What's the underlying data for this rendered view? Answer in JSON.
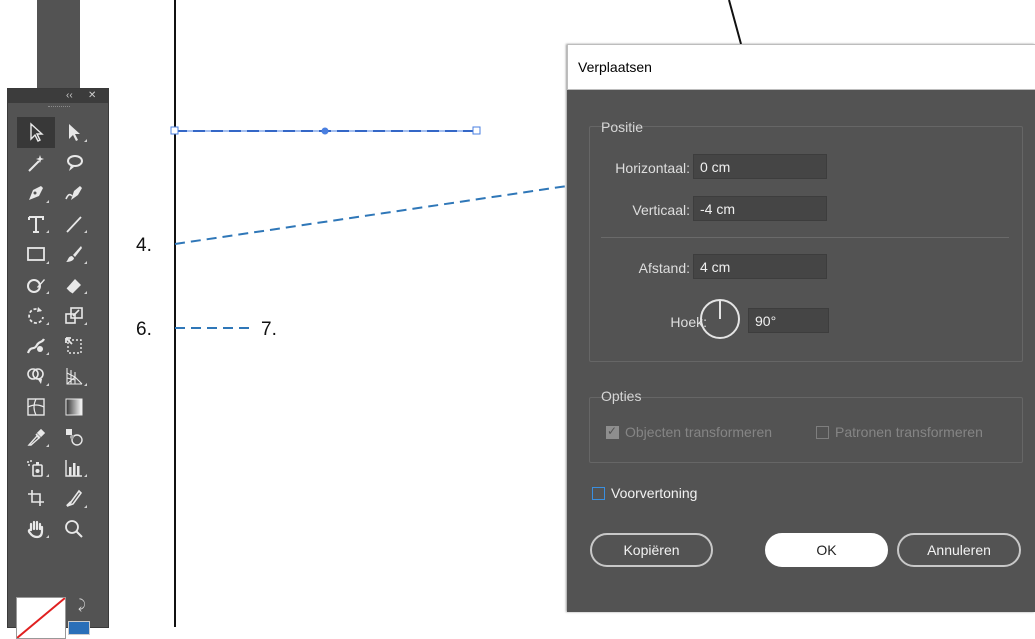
{
  "labels": {
    "item4": "4.",
    "item6": "6.",
    "item7": "7."
  },
  "toolbar": {
    "collapse": "‹‹",
    "close": "✕",
    "tools": [
      {
        "name": "selection-tool",
        "icon": "selection-arrow-icon"
      },
      {
        "name": "direct-selection-tool",
        "icon": "direct-selection-arrow-icon"
      },
      {
        "name": "magic-wand-tool",
        "icon": "magic-wand-icon"
      },
      {
        "name": "lasso-tool",
        "icon": "lasso-icon"
      },
      {
        "name": "pen-tool",
        "icon": "pen-icon"
      },
      {
        "name": "curvature-tool",
        "icon": "curvature-pen-icon"
      },
      {
        "name": "type-tool",
        "icon": "type-icon"
      },
      {
        "name": "line-segment-tool",
        "icon": "line-icon"
      },
      {
        "name": "rectangle-tool",
        "icon": "rectangle-icon"
      },
      {
        "name": "paintbrush-tool",
        "icon": "paintbrush-icon"
      },
      {
        "name": "shaper-tool",
        "icon": "shaper-icon"
      },
      {
        "name": "eraser-tool",
        "icon": "eraser-icon"
      },
      {
        "name": "rotate-tool",
        "icon": "rotate-icon"
      },
      {
        "name": "scale-tool",
        "icon": "scale-icon"
      },
      {
        "name": "warp-tool",
        "icon": "warp-icon"
      },
      {
        "name": "free-transform-tool",
        "icon": "free-transform-icon"
      },
      {
        "name": "shape-builder-tool",
        "icon": "shape-builder-icon"
      },
      {
        "name": "perspective-grid-tool",
        "icon": "perspective-grid-icon"
      },
      {
        "name": "mesh-tool",
        "icon": "mesh-icon"
      },
      {
        "name": "gradient-tool",
        "icon": "gradient-icon"
      },
      {
        "name": "eyedropper-tool",
        "icon": "eyedropper-icon"
      },
      {
        "name": "blend-tool",
        "icon": "blend-icon"
      },
      {
        "name": "symbol-sprayer-tool",
        "icon": "symbol-sprayer-icon"
      },
      {
        "name": "column-graph-tool",
        "icon": "column-graph-icon"
      },
      {
        "name": "artboard-tool",
        "icon": "artboard-icon"
      },
      {
        "name": "slice-tool",
        "icon": "slice-icon"
      },
      {
        "name": "hand-tool",
        "icon": "hand-icon"
      },
      {
        "name": "zoom-tool",
        "icon": "zoom-icon"
      }
    ]
  },
  "dialog": {
    "title": "Verplaatsen",
    "positie": {
      "legend": "Positie",
      "horizontaal_label": "Horizontaal:",
      "horizontaal_value": "0 cm",
      "verticaal_label": "Verticaal:",
      "verticaal_value": "-4 cm",
      "afstand_label": "Afstand:",
      "afstand_value": "4 cm",
      "hoek_label": "Hoek:",
      "hoek_value": "90°"
    },
    "opties": {
      "legend": "Opties",
      "objecten": "Objecten transformeren",
      "patronen": "Patronen transformeren"
    },
    "preview": "Voorvertoning",
    "buttons": {
      "copy": "Kopiëren",
      "ok": "OK",
      "cancel": "Annuleren"
    }
  },
  "colors": {
    "selection": "#4a7fe0",
    "guide": "#2f77b8",
    "dialog_bg": "#535353",
    "toolbar_bg": "#535353"
  }
}
